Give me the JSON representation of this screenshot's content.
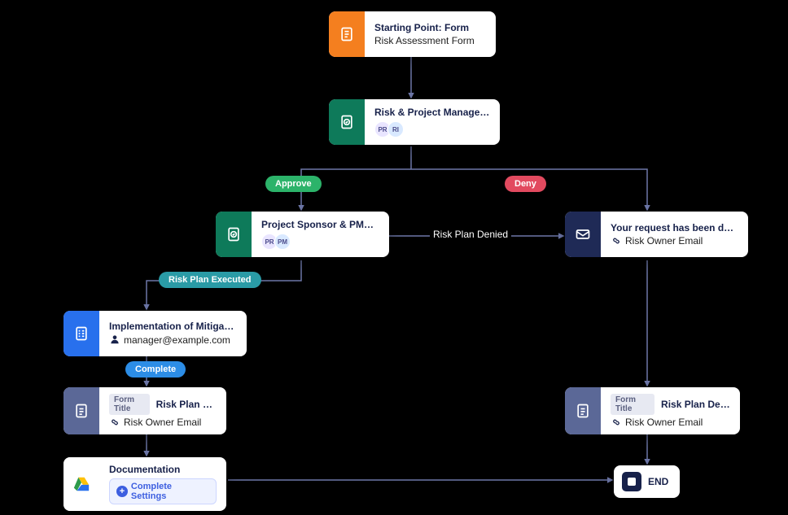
{
  "nodes": {
    "start": {
      "title": "Starting Point: Form",
      "subtitle": "Risk Assessment Form"
    },
    "approval1": {
      "title": "Risk & Project Manager Appr...",
      "avatars": [
        "PR",
        "RI"
      ]
    },
    "approval2": {
      "title": "Project Sponsor & PMO Acti...",
      "avatars": [
        "PR",
        "PM"
      ]
    },
    "email_denied": {
      "title": "Your request has been denied.",
      "subtitle": "Risk Owner Email"
    },
    "task": {
      "title": "Implementation of Mitigatio...",
      "subtitle": "manager@example.com"
    },
    "form_exec": {
      "chip": "Form Title",
      "title": "Risk Plan Exec...",
      "subtitle": "Risk Owner Email"
    },
    "form_denied": {
      "chip": "Form Title",
      "title": "Risk Plan Denied",
      "subtitle": "Risk Owner Email"
    },
    "doc": {
      "title": "Documentation",
      "button": "Complete Settings"
    },
    "end": {
      "label": "END"
    }
  },
  "edges": {
    "approve": "Approve",
    "deny": "Deny",
    "plan_denied": "Risk Plan Denied",
    "plan_executed": "Risk Plan Executed",
    "complete": "Complete"
  },
  "colors": {
    "orange": "#f47f1f",
    "teal": "#0e7a5a",
    "blue": "#2870ed",
    "navy": "#1f2a56",
    "slate": "#5b6897",
    "green_pill": "#2cb36a",
    "red_pill": "#e24a5f",
    "teal_pill": "#2a9ba6",
    "blue_pill": "#2c8de6"
  }
}
